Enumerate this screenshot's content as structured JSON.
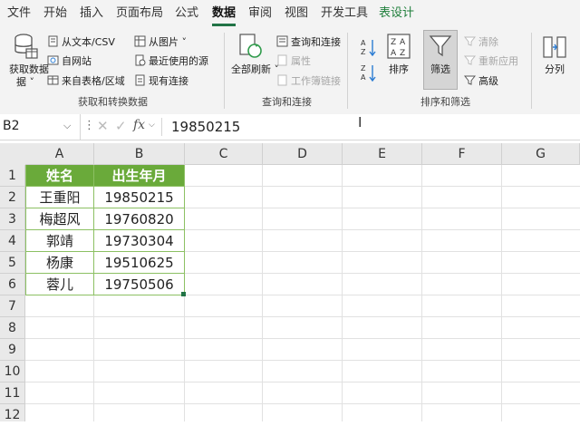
{
  "menu": {
    "items": [
      "文件",
      "开始",
      "插入",
      "页面布局",
      "公式",
      "数据",
      "审阅",
      "视图",
      "开发工具",
      "表设计"
    ],
    "active": "数据"
  },
  "ribbon": {
    "get_data": {
      "label": "获取数据",
      "sub": "据 ˅"
    },
    "from_text_csv": "从文本/CSV",
    "from_web": "自网站",
    "from_table": "来自表格/区域",
    "from_picture": "从图片 ˅",
    "recent_sources": "最近使用的源",
    "existing_connections": "现有连接",
    "group_get_transform": "获取和转换数据",
    "refresh_all": "全部刷新 ˅",
    "queries_connections": "查询和连接",
    "properties": "属性",
    "workbook_links": "工作簿链接",
    "group_queries": "查询和连接",
    "sort": "排序",
    "filter": "筛选",
    "clear": "清除",
    "reapply": "重新应用",
    "advanced": "高级",
    "group_sort_filter": "排序和筛选",
    "split": "分列"
  },
  "formula_bar": {
    "name_box": "B2",
    "dots": "⋮",
    "content": "19850215"
  },
  "grid": {
    "columns": [
      "A",
      "B",
      "C",
      "D",
      "E",
      "F",
      "G"
    ],
    "rows": [
      "1",
      "2",
      "3",
      "4",
      "5",
      "6",
      "7",
      "8",
      "9",
      "10",
      "11",
      "12"
    ],
    "table_headers": [
      "姓名",
      "出生年月"
    ],
    "table_rows": [
      [
        "王重阳",
        "19850215"
      ],
      [
        "梅超风",
        "19760820"
      ],
      [
        "郭靖",
        "19730304"
      ],
      [
        "杨康",
        "19510625"
      ],
      [
        "蓉儿",
        "19750506"
      ]
    ]
  },
  "colors": {
    "table_header_fill": "#6aaa3a",
    "accent": "#217346"
  }
}
